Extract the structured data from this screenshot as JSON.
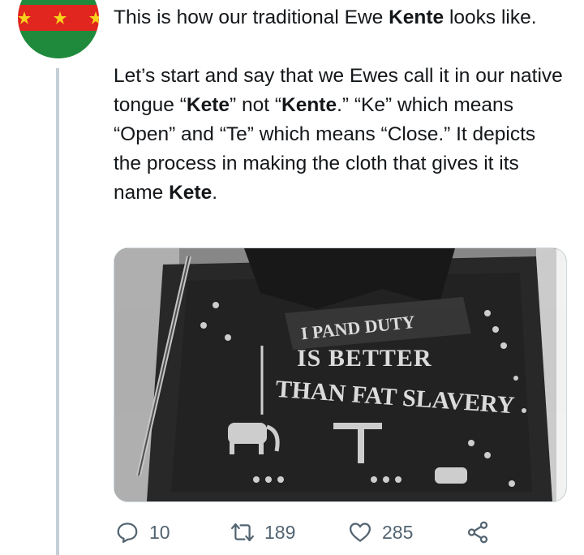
{
  "tweet": {
    "paragraph1": [
      {
        "text": "This is how our traditional Ewe ",
        "bold": false
      },
      {
        "text": "Kente",
        "bold": true
      },
      {
        "text": " looks like.",
        "bold": false
      }
    ],
    "paragraph2": [
      {
        "text": "Let’s start and say that we Ewes call it in our native tongue “",
        "bold": false
      },
      {
        "text": "Kete",
        "bold": true
      },
      {
        "text": "” not “",
        "bold": false
      },
      {
        "text": "Kente",
        "bold": true
      },
      {
        "text": ".” “Ke” which means “Open” and “Te” which means “Close.” It depicts the process in making the cloth that gives it its name ",
        "bold": false
      },
      {
        "text": "Kete",
        "bold": true
      },
      {
        "text": ".",
        "bold": false
      }
    ]
  },
  "media": {
    "cloth_text": [
      "I PAND DUTY",
      "IS BETTER",
      "THAN FAT SLAVERY"
    ]
  },
  "actions": {
    "reply_count": "10",
    "retweet_count": "189",
    "like_count": "285"
  },
  "colors": {
    "flag_green": "#1f8a3b",
    "flag_red": "#e0261f",
    "flag_star": "#f6d21c",
    "muted": "#536471",
    "thread_line": "#c4cfd6"
  },
  "icons": [
    "reply-icon",
    "retweet-icon",
    "like-icon",
    "share-icon",
    "star-icon"
  ]
}
